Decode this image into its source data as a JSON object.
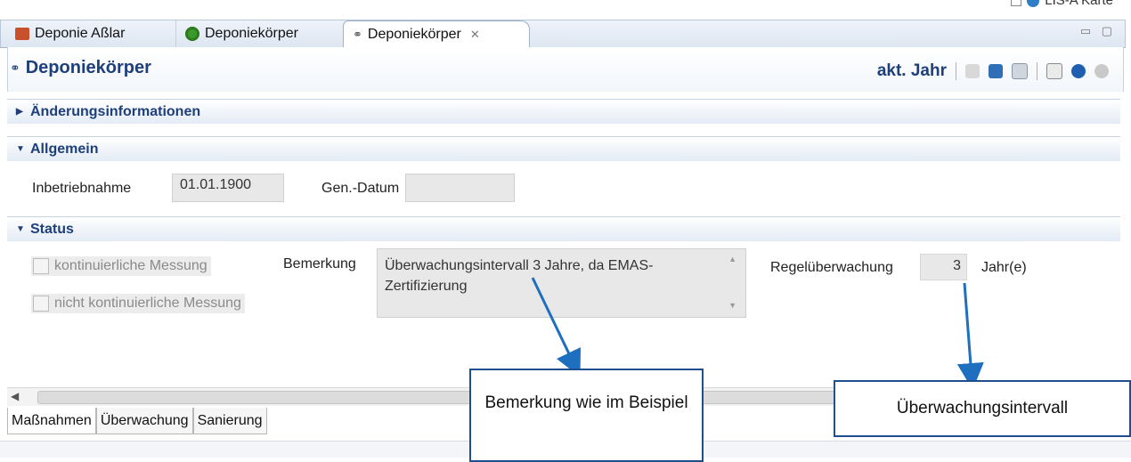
{
  "top": {
    "partial_label": "LIS-A Karte"
  },
  "tabs": [
    {
      "label": "Deponie Aßlar",
      "icon": "house-icon"
    },
    {
      "label": "Deponiekörper",
      "icon": "gear-icon"
    },
    {
      "label": "Deponiekörper",
      "icon": "glasses-icon",
      "active": true
    }
  ],
  "form": {
    "title": "Deponiekörper",
    "toolbar_label": "akt. Jahr"
  },
  "sections": {
    "changes": "Änderungsinformationen",
    "general": "Allgemein",
    "status": "Status"
  },
  "general": {
    "inbetriebnahme_label": "Inbetriebnahme",
    "inbetriebnahme_value": "01.01.1900",
    "gendatum_label": "Gen.-Datum",
    "gendatum_value": ""
  },
  "status": {
    "kontinuierlich": "kontinuierliche Messung",
    "nicht_kontinuierlich": "nicht kontinuierliche Messung",
    "bemerkung_label": "Bemerkung",
    "bemerkung_value": "Überwachungsintervall 3 Jahre, da EMAS-Zertifizierung",
    "regel_label": "Regelüberwachung",
    "regel_value": "3",
    "regel_unit": "Jahr(e)"
  },
  "bottom_tabs": [
    "Maßnahmen",
    "Überwachung",
    "Sanierung"
  ],
  "annotations": {
    "bemerkung_callout": "Bemerkung wie im Beispiel",
    "interval_callout": "Überwachungsintervall"
  },
  "colors": {
    "accent": "#1d3f7a",
    "callout_border": "#1f4e8c",
    "arrow": "#1f6fc0"
  }
}
